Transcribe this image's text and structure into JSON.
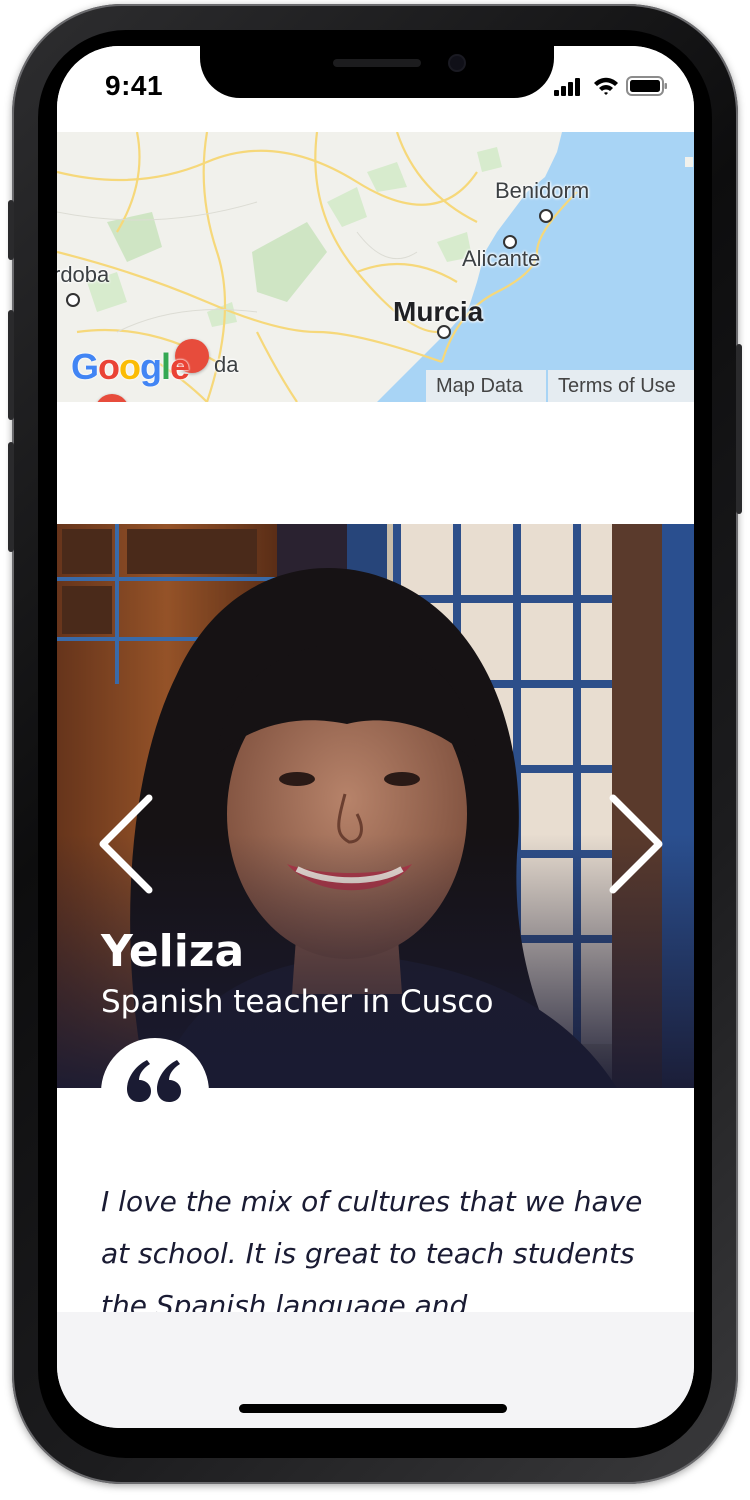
{
  "status_bar": {
    "time": "9:41"
  },
  "map": {
    "cities": [
      {
        "name": "Benidorm",
        "size": "small"
      },
      {
        "name": "Alicante",
        "size": "small"
      },
      {
        "name": "rdoba",
        "size": "small"
      },
      {
        "name": "Murcia",
        "size": "big"
      },
      {
        "name": "da",
        "size": "small"
      }
    ],
    "logo": "Google",
    "map_data_label": "Map Data",
    "terms_label": "Terms of Use"
  },
  "testimonial": {
    "name": "Yeliza",
    "role": "Spanish teacher in Cusco",
    "quote": "I love the mix of cultures that we have at school. It is great to teach students the Spanish language and"
  },
  "colors": {
    "ink": "#1a1b33",
    "sea": "#a8d4f5",
    "accent_pin": "#e74c3c"
  },
  "icons": [
    "signal-icon",
    "wifi-icon",
    "battery-icon",
    "chevron-left-icon",
    "chevron-right-icon",
    "quote-icon"
  ]
}
